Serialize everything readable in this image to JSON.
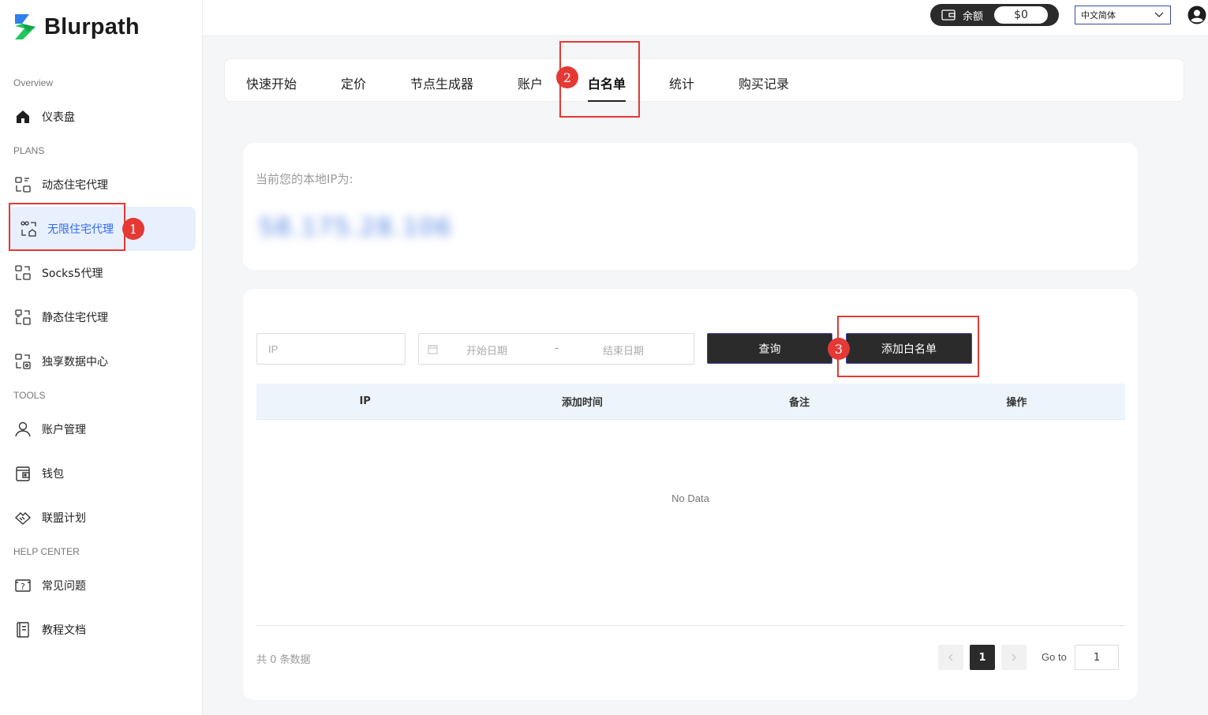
{
  "brand": {
    "name": "Blurpath",
    "colors": {
      "accent": "#2f6bff",
      "brand_green": "#22c55e",
      "brand_blue": "#2f80ed",
      "dark": "#2b2b2b",
      "annotation": "#e53935"
    }
  },
  "sidebar": {
    "sections": {
      "overview": "Overview",
      "plans": "PLANS",
      "tools": "TOOLS",
      "help": "HELP CENTER"
    },
    "items": [
      {
        "label": "仪表盘",
        "icon": "home-icon"
      },
      {
        "label": "动态住宅代理",
        "icon": "proxy-icon"
      },
      {
        "label": "无限住宅代理",
        "icon": "unlimited-proxy-icon",
        "active": true
      },
      {
        "label": "Socks5代理",
        "icon": "socks5-icon"
      },
      {
        "label": "静态住宅代理",
        "icon": "static-proxy-icon"
      },
      {
        "label": "独享数据中心",
        "icon": "datacenter-icon"
      },
      {
        "label": "账户管理",
        "icon": "user-icon"
      },
      {
        "label": "钱包",
        "icon": "wallet-icon"
      },
      {
        "label": "联盟计划",
        "icon": "handshake-icon"
      },
      {
        "label": "常见问题",
        "icon": "faq-icon"
      },
      {
        "label": "教程文档",
        "icon": "document-icon"
      }
    ]
  },
  "header": {
    "balance_label": "余额",
    "balance_amount": "$0",
    "language": "中文简体"
  },
  "tabs": [
    {
      "label": "快速开始"
    },
    {
      "label": "定价"
    },
    {
      "label": "节点生成器"
    },
    {
      "label": "账户"
    },
    {
      "label": "白名单",
      "active": true
    },
    {
      "label": "统计"
    },
    {
      "label": "购买记录"
    }
  ],
  "ip_card": {
    "label": "当前您的本地IP为:",
    "value": "58.175.28.106"
  },
  "filter": {
    "ip_placeholder": "IP",
    "start_date_placeholder": "开始日期",
    "date_separator": "-",
    "end_date_placeholder": "结束日期",
    "query_button": "查询",
    "add_button": "添加白名单"
  },
  "table": {
    "columns": [
      "IP",
      "添加时间",
      "备注",
      "操作"
    ],
    "empty_text": "No Data"
  },
  "pagination": {
    "total_text": "共 0 条数据",
    "current_page": "1",
    "goto_label": "Go to",
    "goto_value": "1"
  },
  "annotations": [
    "1",
    "2",
    "3"
  ]
}
